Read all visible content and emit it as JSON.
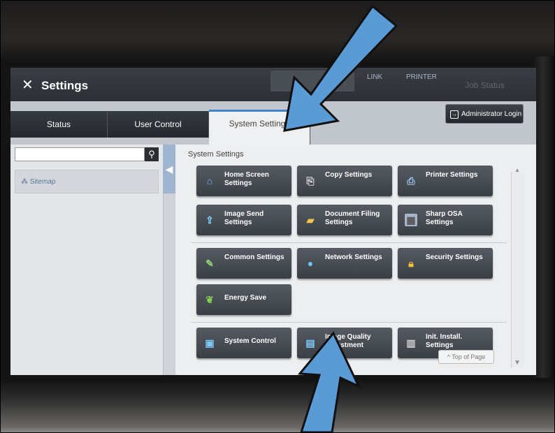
{
  "header": {
    "title": "Settings",
    "link_label": "LINK",
    "printer_label": "PRINTER",
    "job_status": "Job Status"
  },
  "tabs": [
    {
      "label": "Status"
    },
    {
      "label": "User Control"
    },
    {
      "label": "System Settings"
    }
  ],
  "admin_login": "Administrator Login",
  "sidebar": {
    "search_placeholder": "",
    "sitemap_label": "Sitemap"
  },
  "main": {
    "section_title": "System Settings",
    "buttons": [
      {
        "label": "Home Screen Settings",
        "icon": "home-icon"
      },
      {
        "label": "Copy Settings",
        "icon": "copy-icon"
      },
      {
        "label": "Printer Settings",
        "icon": "printer-icon"
      },
      {
        "label": "Image Send Settings",
        "icon": "image-send-icon"
      },
      {
        "label": "Document Filing Settings",
        "icon": "folder-icon"
      },
      {
        "label": "Sharp OSA Settings",
        "icon": "osa-icon"
      },
      {
        "label": "Common Settings",
        "icon": "common-settings-icon"
      },
      {
        "label": "Network Settings",
        "icon": "network-icon"
      },
      {
        "label": "Security Settings",
        "icon": "lock-icon"
      },
      {
        "label": "Energy Save",
        "icon": "leaf-icon"
      },
      {
        "label": "System Control",
        "icon": "system-control-icon"
      },
      {
        "label": "Image Quality Adjustment",
        "icon": "image-quality-icon"
      },
      {
        "label": "Init. Install. Settings",
        "icon": "init-install-icon"
      }
    ],
    "top_of_page": "Top of Page"
  },
  "colors": {
    "arrow": "#5b9bd5",
    "active_tab_border": "#3f83c8"
  }
}
